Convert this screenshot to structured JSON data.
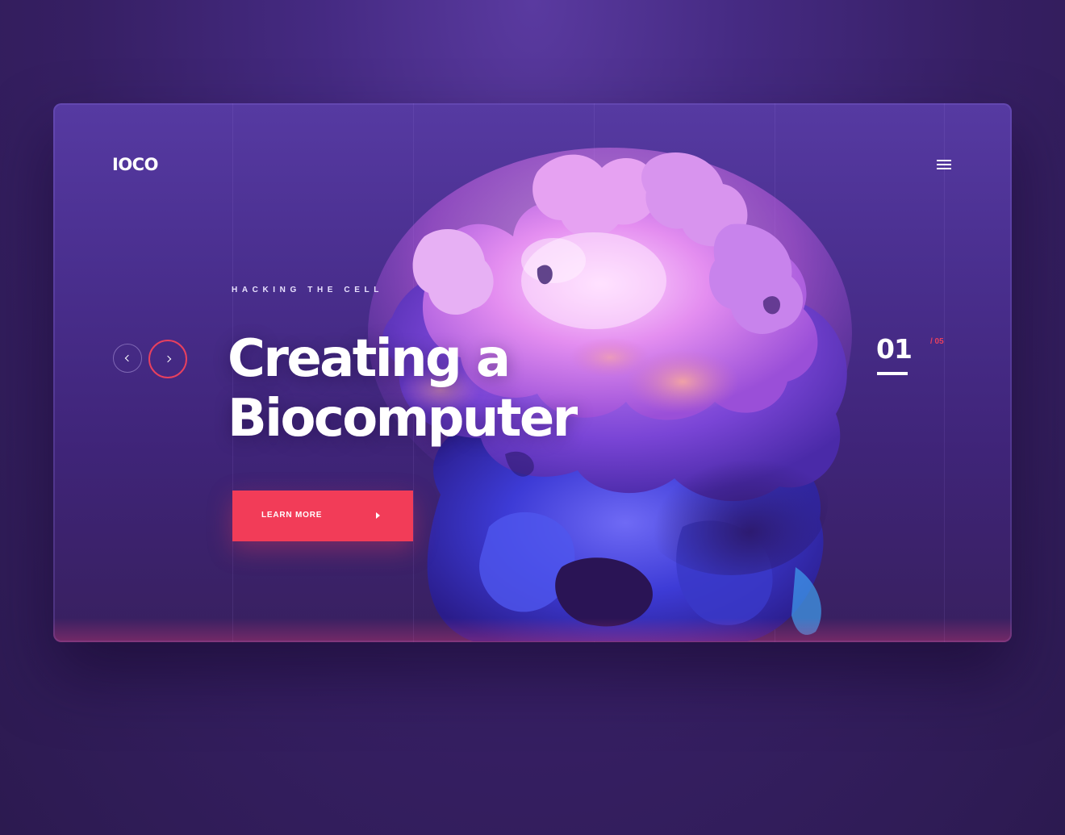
{
  "header": {
    "logo": "IOCO",
    "menu_icon": "hamburger-icon"
  },
  "hero": {
    "eyebrow": "HACKING THE CELL",
    "headline_line1": "Creating a",
    "headline_line2": "Biocomputer",
    "cta_label": "LEARN MORE",
    "cta_icon": "play-arrow-icon"
  },
  "slider": {
    "prev_icon": "chevron-left-icon",
    "next_icon": "chevron-right-icon",
    "current": "01",
    "total": "/ 05"
  },
  "colors": {
    "accent": "#f23c58",
    "background": "#3a2268",
    "card": "#4a2f8f",
    "text": "#ffffff"
  }
}
